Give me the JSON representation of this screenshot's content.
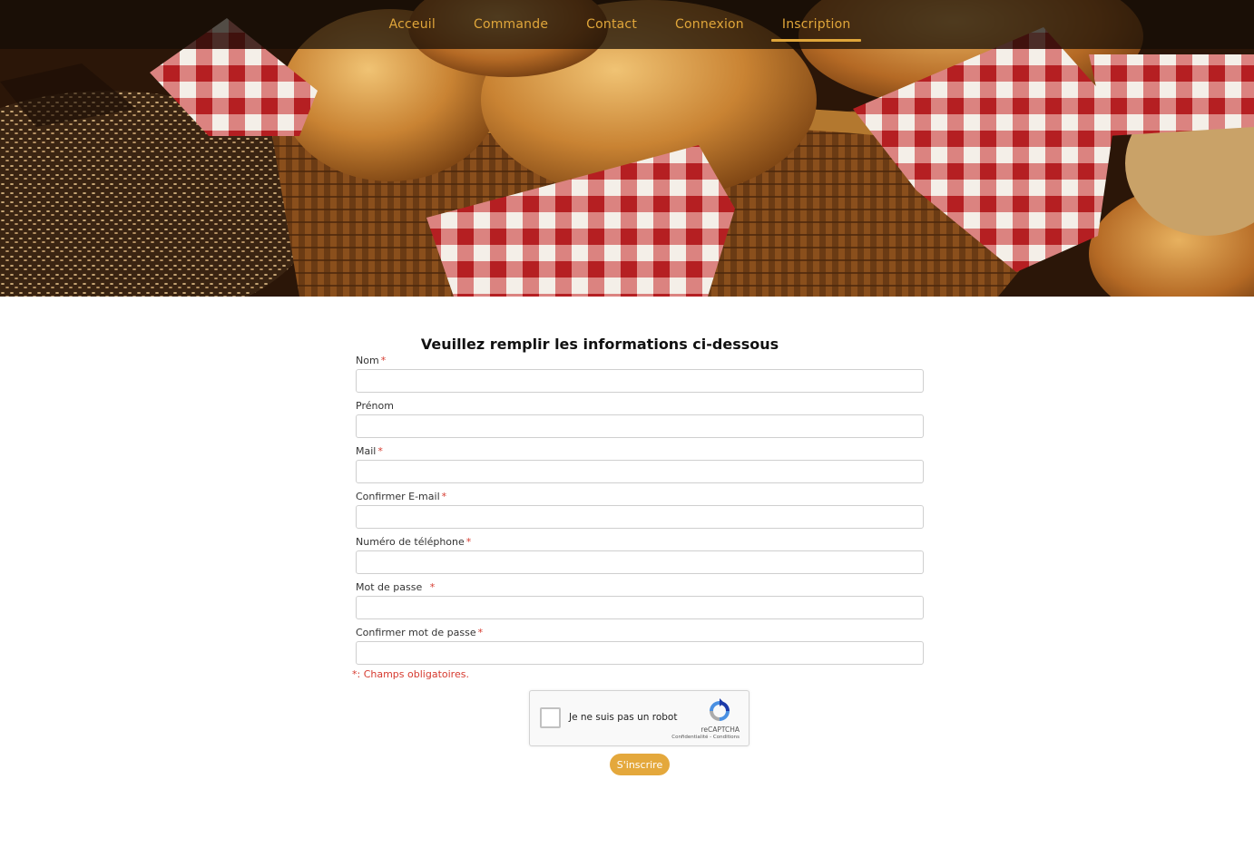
{
  "nav": {
    "items": [
      {
        "label": "Acceuil"
      },
      {
        "label": "Commande"
      },
      {
        "label": "Contact"
      },
      {
        "label": "Connexion"
      },
      {
        "label": "Inscription",
        "active": true
      }
    ],
    "accent_color": "#e0a63a"
  },
  "form": {
    "title": "Veuillez remplir les informations ci-dessous",
    "fields": [
      {
        "label": "Nom",
        "required": "*",
        "value": ""
      },
      {
        "label": "Prénom",
        "required": "",
        "value": ""
      },
      {
        "label": "Mail",
        "required": "*",
        "value": ""
      },
      {
        "label": "Confirmer E-mail",
        "required": "*",
        "value": ""
      },
      {
        "label": "Numéro de téléphone",
        "required": "*",
        "value": ""
      },
      {
        "label": "Mot de passe ",
        "required": "*",
        "value": ""
      },
      {
        "label": "Confirmer mot de passe",
        "required": "*",
        "value": ""
      }
    ],
    "required_note": "*: Champs obligatoires.",
    "required_color": "#d63a2f"
  },
  "captcha": {
    "label": "Je ne suis pas un robot",
    "brand": "reCAPTCHA",
    "links": "Confidentialité - Conditions"
  },
  "submit": {
    "label": "S'inscrire",
    "color": "#e4a83c"
  }
}
